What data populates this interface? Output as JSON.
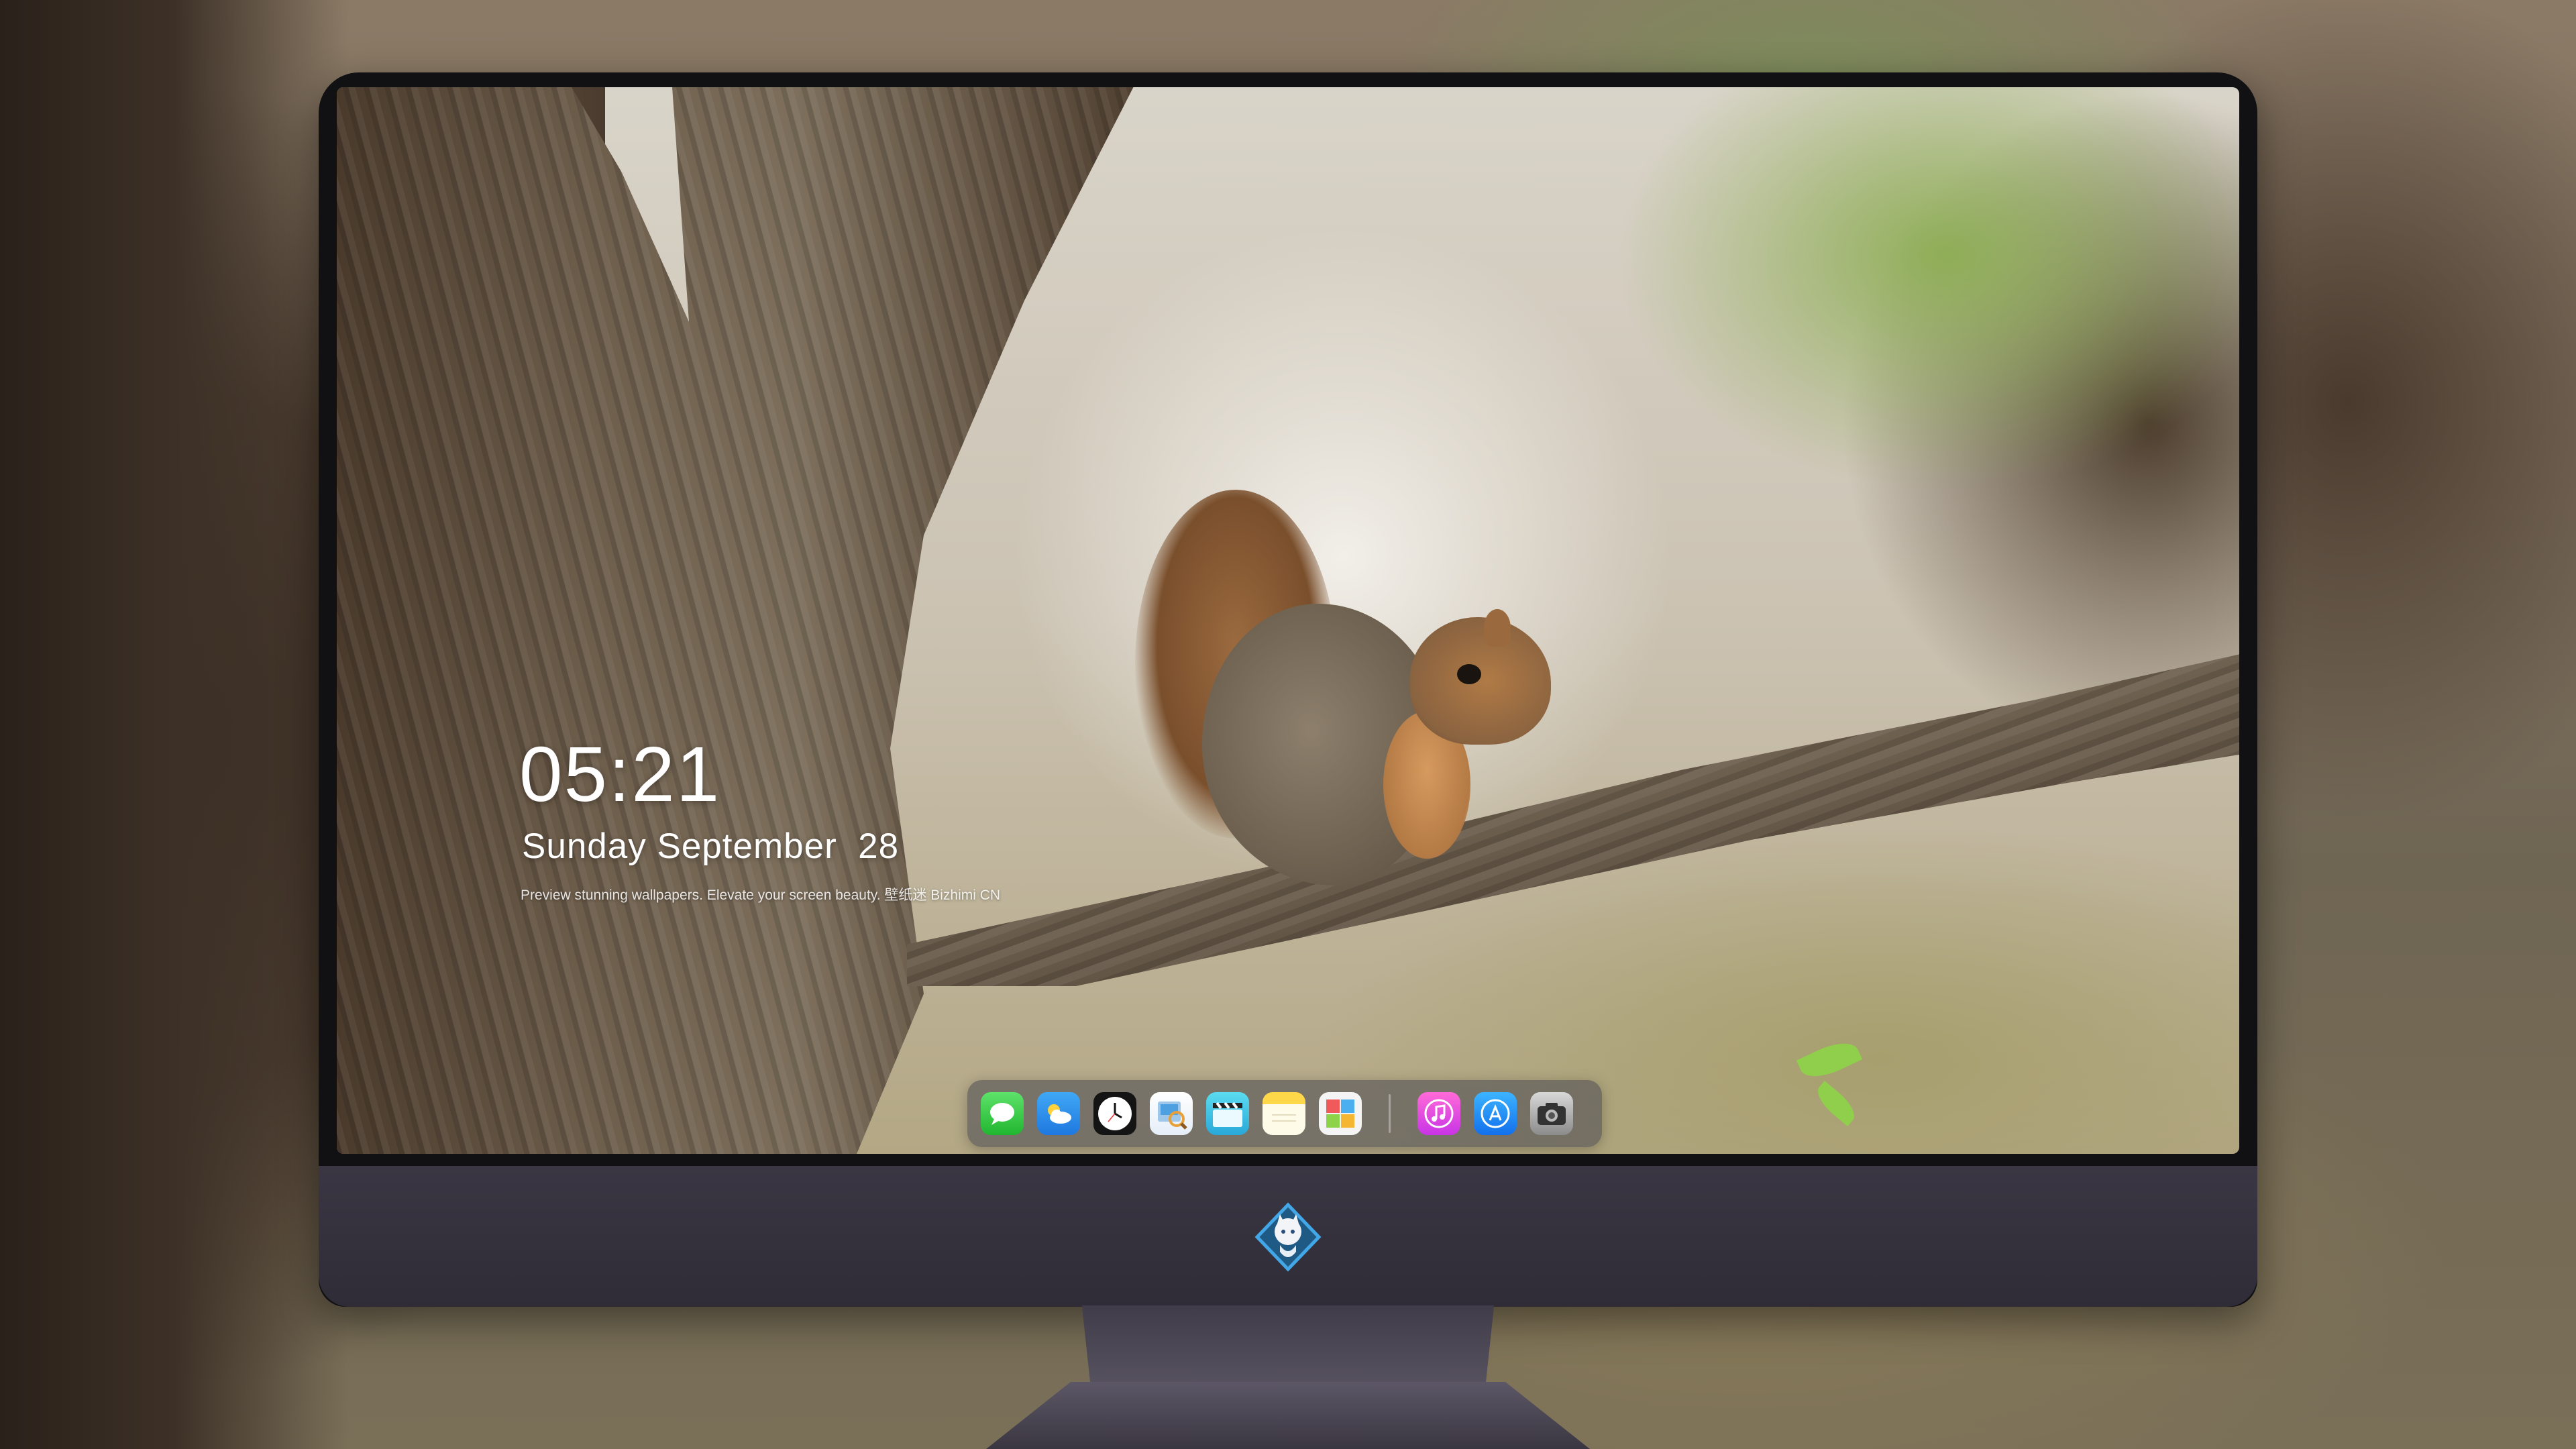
{
  "lockscreen": {
    "time": "05:21",
    "date": "Sunday September  28",
    "tagline": "Preview stunning wallpapers. Elevate your screen beauty. 壁纸迷 Bizhimi CN"
  },
  "dock": {
    "apps": [
      {
        "name": "messages-icon",
        "color": "#2fc93c"
      },
      {
        "name": "weather-icon",
        "color": "#2f8fee"
      },
      {
        "name": "clock-icon",
        "color": "#141414"
      },
      {
        "name": "preview-icon",
        "color": "#e5eef8"
      },
      {
        "name": "video-icon",
        "color": "#3ec3e5"
      },
      {
        "name": "notes-icon",
        "color": "#ffd84a"
      },
      {
        "name": "photos-icon",
        "color": "#f4f4f4"
      },
      {
        "name": "music-icon",
        "color": "#e14fe0"
      },
      {
        "name": "app-store-icon",
        "color": "#2692f5"
      },
      {
        "name": "camera-icon",
        "color": "#a8a8a8"
      }
    ]
  },
  "monitor": {
    "logo": "mascot-logo",
    "bezel_color": "#111114",
    "chin_color": "#35313e"
  }
}
